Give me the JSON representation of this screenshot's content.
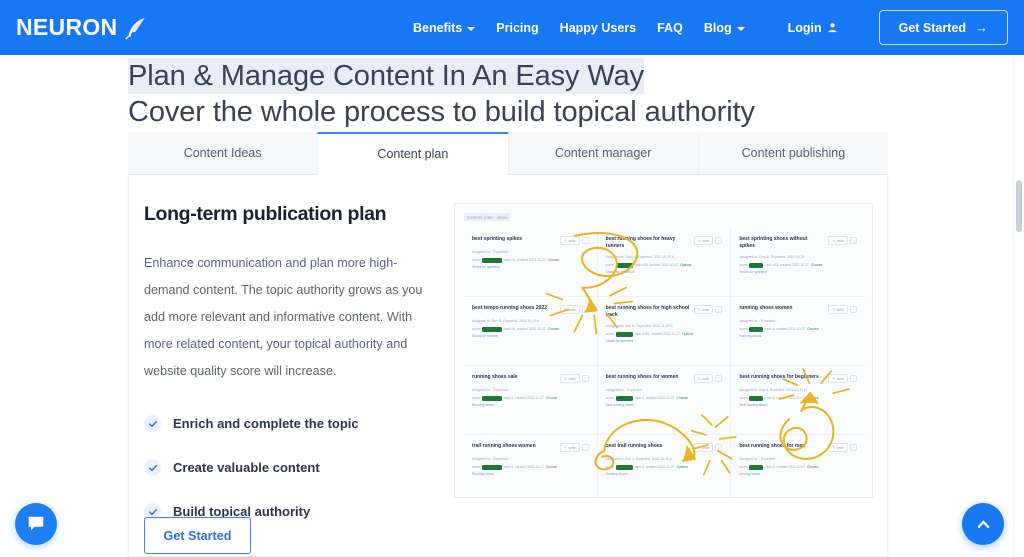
{
  "navbar": {
    "brand": "NEURON",
    "brand_icon": "feather-icon",
    "links": [
      {
        "label": "Benefits",
        "has_caret": true
      },
      {
        "label": "Pricing",
        "has_caret": false
      },
      {
        "label": "Happy Users",
        "has_caret": false
      },
      {
        "label": "FAQ",
        "has_caret": false
      },
      {
        "label": "Blog",
        "has_caret": true
      }
    ],
    "login": "Login",
    "cta": "Get Started",
    "cta_arrow": "→",
    "bg_color": "#1877F2"
  },
  "hero": {
    "line1": "Plan & Manage Content In An Easy Way",
    "line2": "Cover the whole process to build topical authority",
    "highlight_color": "#e8edf7",
    "text_color": "#3b4158"
  },
  "tabs": {
    "items": [
      {
        "label": "Content Ideas",
        "active": false
      },
      {
        "label": "Content plan",
        "active": true
      },
      {
        "label": "Content manager",
        "active": false
      },
      {
        "label": "Content publishing",
        "active": false
      }
    ],
    "active_index": 1,
    "accent_color": "#2d8cf0"
  },
  "feature": {
    "title": "Long-term publication plan",
    "body": "Enhance communication and plan more high-demand content. The topic authority grows as you add more relevant and informative content. With more related content, your topical authority and website quality score will increase.",
    "checklist": [
      "Enrich and complete the topic",
      "Create valuable content",
      "Build topical authority"
    ],
    "cta": "Get Started",
    "cta_color": "#2f6fe0"
  },
  "app_screenshot": {
    "breadcrumb": "Content plan - ideas",
    "card_action_label": "write",
    "cards": [
      {
        "title": "best sprinting spikes",
        "meta": "Assigned to: ·  Expected: ·",
        "score": "rank #1, created 2023-10-27",
        "link": "Shoes for sprinting",
        "tag": "Choose"
      },
      {
        "title": "best running shoes for heavy runners",
        "meta": "Assigned to: Greg A.   Expected: 2022-10-25 A",
        "score": "rank #40, created 2022-10-27",
        "link": "Shoes for marathon",
        "tag": "Options"
      },
      {
        "title": "best sprinting shoes without spikes",
        "meta": "Assigned to:  Cory A.   Expected: 2022-10-23",
        "score": "rank #13, created 2022-10-27",
        "link": "Shoes for sprinters",
        "tag": "Choose"
      },
      {
        "title": "best tempo running shoes 2022",
        "meta": "Assigned to: Ron R.   Expected: 2022-10-29 b",
        "score": "rank #4, created 2022-10-27",
        "link": "Shoes for running",
        "tag": "Choose"
      },
      {
        "title": "best running shoes for high school track",
        "meta": "Assigned to: Ann H.   Expected: 2022-11-40 C",
        "score": "rank #781, created 2022-10-27",
        "link": "Shoes for sprinters",
        "tag": "Options"
      },
      {
        "title": "running shoes women",
        "meta": "Assigned to: ·  Expected: ·",
        "score": "rank #, created 2022-10-27",
        "link": "Running shoes",
        "tag": "Choose"
      },
      {
        "title": "running shoes sale",
        "meta": "Assigned to: ·  Expected: ·",
        "score": "rank #, created 2022-10-27",
        "link": "Running shoes",
        "tag": "Choose"
      },
      {
        "title": "best running shoes for women",
        "meta": "Assigned to: ·  Expected: ·",
        "score": "rank #, created 2022-10-27",
        "link": "Best running shoes",
        "tag": "Choose"
      },
      {
        "title": "best running shoes for beginners",
        "meta": "Assigned to: Gus A.   Expected: 2022-10-11 pl",
        "score": "rank #, created 2022-10-27",
        "link": "Best running shoes",
        "tag": "Choose"
      },
      {
        "title": "trail running shoes women",
        "meta": "Assigned to: ·  Expected: ·",
        "score": "rank #, created 2022-10-27",
        "link": "Running shoes",
        "tag": "Choose"
      },
      {
        "title": "best trail running shoes",
        "meta": "Assigned to: Pol. J.   Expected: 2022-10-11 p",
        "score": "rank #, created 2022-10-27",
        "link": "Running shoes",
        "tag": "Options"
      },
      {
        "title": "best running shoes for men",
        "meta": "Assigned to: ·  Expected: ·",
        "score": "rank #, created 2022-10-27",
        "link": "running shoes",
        "tag": "Choose"
      }
    ]
  },
  "floating": {
    "chat_icon": "chat-bubble-icon",
    "scroll_top_icon": "chevron-up-icon",
    "accent": "#1877F2"
  }
}
